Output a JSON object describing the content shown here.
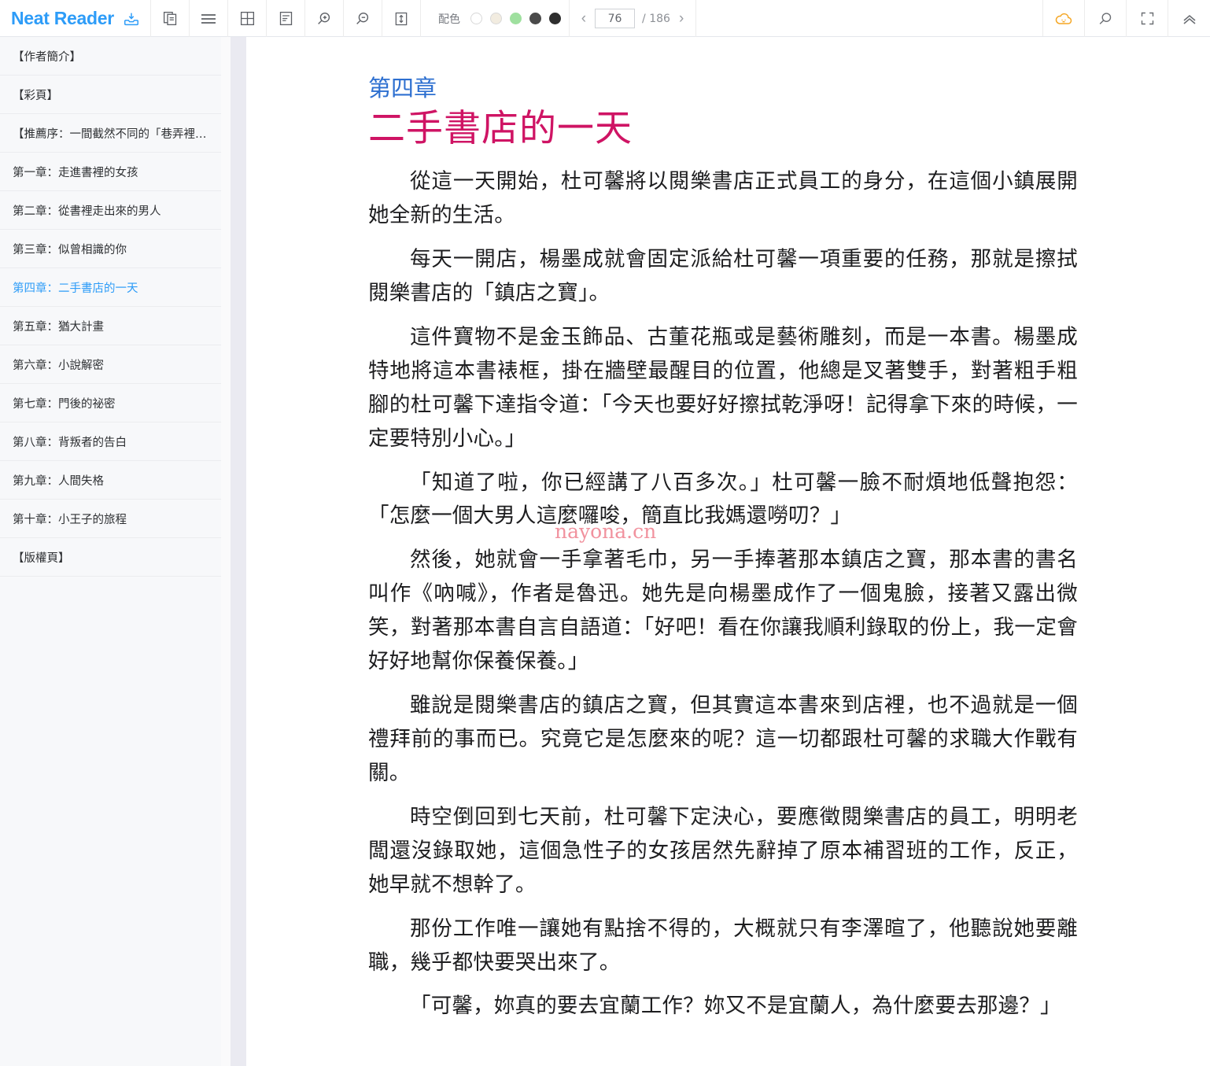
{
  "toolbar": {
    "app_name": "Neat Reader",
    "icons": [
      {
        "name": "save-to-library-icon",
        "label": "save"
      },
      {
        "name": "copy-pages-icon",
        "label": "copy"
      },
      {
        "name": "hamburger-menu-icon",
        "label": "menu"
      },
      {
        "name": "grid-layout-icon",
        "label": "grid"
      },
      {
        "name": "text-layout-icon",
        "label": "layout"
      },
      {
        "name": "zoom-in-icon",
        "label": "zoom in"
      },
      {
        "name": "zoom-out-icon",
        "label": "zoom out"
      },
      {
        "name": "line-height-icon",
        "label": "line height"
      }
    ],
    "color_scheme": {
      "label": "配色",
      "swatches": [
        "#ffffff",
        "#f2ece0",
        "#9fe09f",
        "#4a4a4a",
        "#2e2e2e"
      ],
      "selected_index": 0
    },
    "pager": {
      "prev_label": "‹",
      "current_page": "76",
      "separator": "/ 186",
      "next_label": "›"
    },
    "right_icons": [
      {
        "name": "cloud-sync-icon",
        "color": "#f5a623"
      },
      {
        "name": "search-icon",
        "color": "#6b6e73"
      },
      {
        "name": "fullscreen-icon",
        "color": "#6b6e73"
      },
      {
        "name": "collapse-up-icon",
        "color": "#6b6e73"
      }
    ],
    "accent_color": "#2d9cf8"
  },
  "sidebar": {
    "items": [
      {
        "label": "【作者簡介】",
        "active": false
      },
      {
        "label": "【彩頁】",
        "active": false
      },
      {
        "label": "【推薦序：一間截然不同的「巷弄裡的…",
        "active": false
      },
      {
        "label": "第一章：走進書裡的女孩",
        "active": false
      },
      {
        "label": "第二章：從書裡走出來的男人",
        "active": false
      },
      {
        "label": "第三章：似曾相識的你",
        "active": false
      },
      {
        "label": "第四章：二手書店的一天",
        "active": true
      },
      {
        "label": "第五章：猶大計畫",
        "active": false
      },
      {
        "label": "第六章：小說解密",
        "active": false
      },
      {
        "label": "第七章：門後的祕密",
        "active": false
      },
      {
        "label": "第八章：背叛者的告白",
        "active": false
      },
      {
        "label": "第九章：人間失格",
        "active": false
      },
      {
        "label": "第十章：小王子的旅程",
        "active": false
      },
      {
        "label": "【版權頁】",
        "active": false
      }
    ],
    "active_color": "#2d9cf8"
  },
  "content": {
    "chapter_label": "第四章",
    "chapter_title": "二手書店的一天",
    "chapter_label_color": "#2d6fd0",
    "chapter_title_color": "#cf1464",
    "watermark": "nayona.cn",
    "paragraphs": [
      "從這一天開始，杜可馨將以閱樂書店正式員工的身分，在這個小鎮展開她全新的生活。",
      "每天一開店，楊墨成就會固定派給杜可馨一項重要的任務，那就是擦拭閱樂書店的「鎮店之寶」。",
      "這件寶物不是金玉飾品、古董花瓶或是藝術雕刻，而是一本書。楊墨成特地將這本書裱框，掛在牆壁最醒目的位置，他總是叉著雙手，對著粗手粗腳的杜可馨下達指令道：「今天也要好好擦拭乾淨呀！記得拿下來的時候，一定要特別小心。」",
      "「知道了啦，你已經講了八百多次。」杜可馨一臉不耐煩地低聲抱怨：「怎麼一個大男人這麼囉唆，簡直比我媽還嘮叨？」",
      "然後，她就會一手拿著毛巾，另一手捧著那本鎮店之寶，那本書的書名叫作《吶喊》，作者是魯迅。她先是向楊墨成作了一個鬼臉，接著又露出微笑，對著那本書自言自語道：「好吧！看在你讓我順利錄取的份上，我一定會好好地幫你保養保養。」",
      "雖說是閱樂書店的鎮店之寶，但其實這本書來到店裡，也不過就是一個禮拜前的事而已。究竟它是怎麼來的呢？這一切都跟杜可馨的求職大作戰有關。",
      "時空倒回到七天前，杜可馨下定決心，要應徵閱樂書店的員工，明明老闆還沒錄取她，這個急性子的女孩居然先辭掉了原本補習班的工作，反正，她早就不想幹了。",
      "那份工作唯一讓她有點捨不得的，大概就只有李澤暄了，他聽說她要離職，幾乎都快要哭出來了。",
      "「可馨，妳真的要去宜蘭工作？妳又不是宜蘭人，為什麼要去那邊？」"
    ]
  }
}
